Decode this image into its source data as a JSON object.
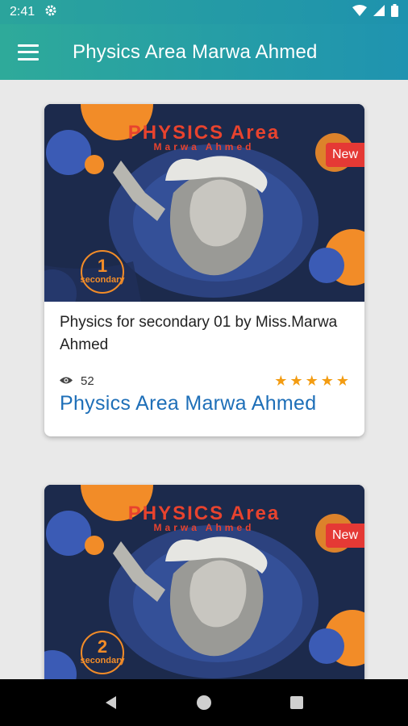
{
  "status_bar": {
    "time": "2:41"
  },
  "app_bar": {
    "title": "Physics Area Marwa Ahmed"
  },
  "cards": [
    {
      "poster_title": "PHYSICS Area",
      "poster_subtitle": "Marwa Ahmed",
      "grade_number": "1",
      "grade_word": "secondary",
      "badge": "New",
      "title": " Physics for secondary 01 by Miss.Marwa Ahmed",
      "views": "52",
      "rating": 5,
      "author": "Physics Area Marwa Ahmed"
    },
    {
      "poster_title": "PHYSICS Area",
      "poster_subtitle": "Marwa Ahmed",
      "grade_number": "2",
      "grade_word": "secondary",
      "badge": "New"
    }
  ],
  "colors": {
    "accent": "#1e6fb8",
    "badge": "#e53935",
    "star": "#f39c12",
    "appbar_start": "#2eaa9a",
    "appbar_end": "#1f93b0"
  }
}
